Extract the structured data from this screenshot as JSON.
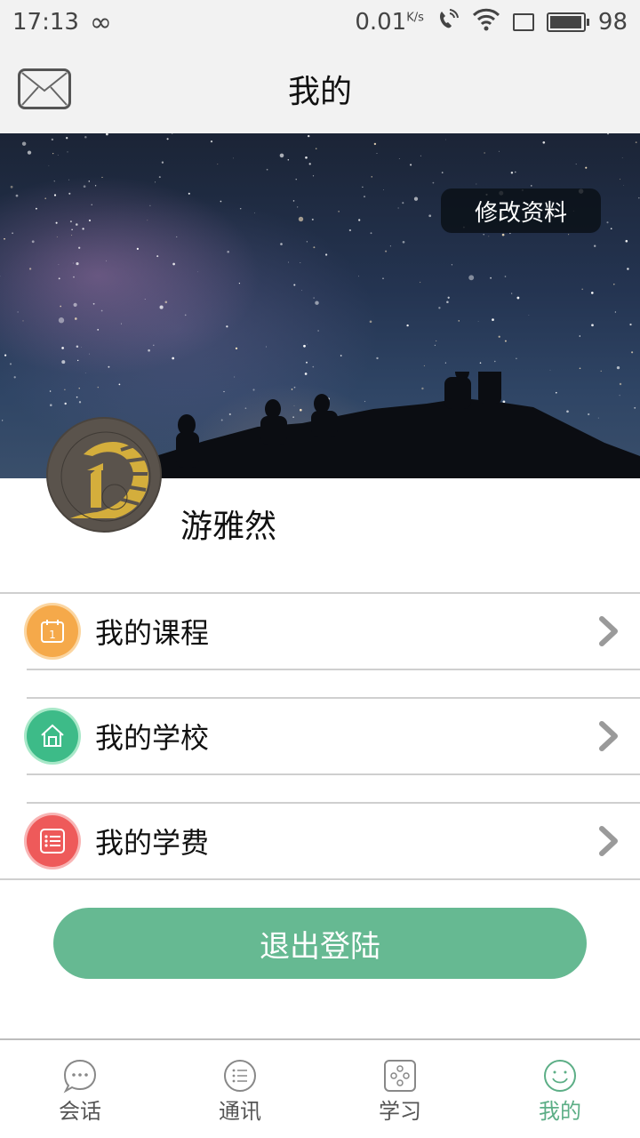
{
  "status_bar": {
    "time": "17:13",
    "net_speed": "0.01",
    "net_unit": "K/s",
    "battery": "98",
    "battery_level_percent": 98
  },
  "header": {
    "title": "我的",
    "mail_icon": "envelope-icon"
  },
  "banner": {
    "edit_profile_label": "修改资料"
  },
  "profile": {
    "username": "游雅然",
    "avatar_icon": "school-logo-icon"
  },
  "menu": {
    "items": [
      {
        "label": "我的课程",
        "icon": "calendar-icon",
        "color": "#f5a94a"
      },
      {
        "label": "我的学校",
        "icon": "house-icon",
        "color": "#3dbb88"
      },
      {
        "label": "我的学费",
        "icon": "list-icon",
        "color": "#ee5a5a"
      }
    ]
  },
  "logout": {
    "label": "退出登陆",
    "color": "#66b992"
  },
  "tabbar": {
    "active_color": "#5cae86",
    "tabs": [
      {
        "label": "会话",
        "icon": "chat-bubble-icon",
        "active": false
      },
      {
        "label": "通讯",
        "icon": "contacts-list-icon",
        "active": false
      },
      {
        "label": "学习",
        "icon": "study-dice-icon",
        "active": false
      },
      {
        "label": "我的",
        "icon": "smiley-icon",
        "active": true
      }
    ]
  }
}
